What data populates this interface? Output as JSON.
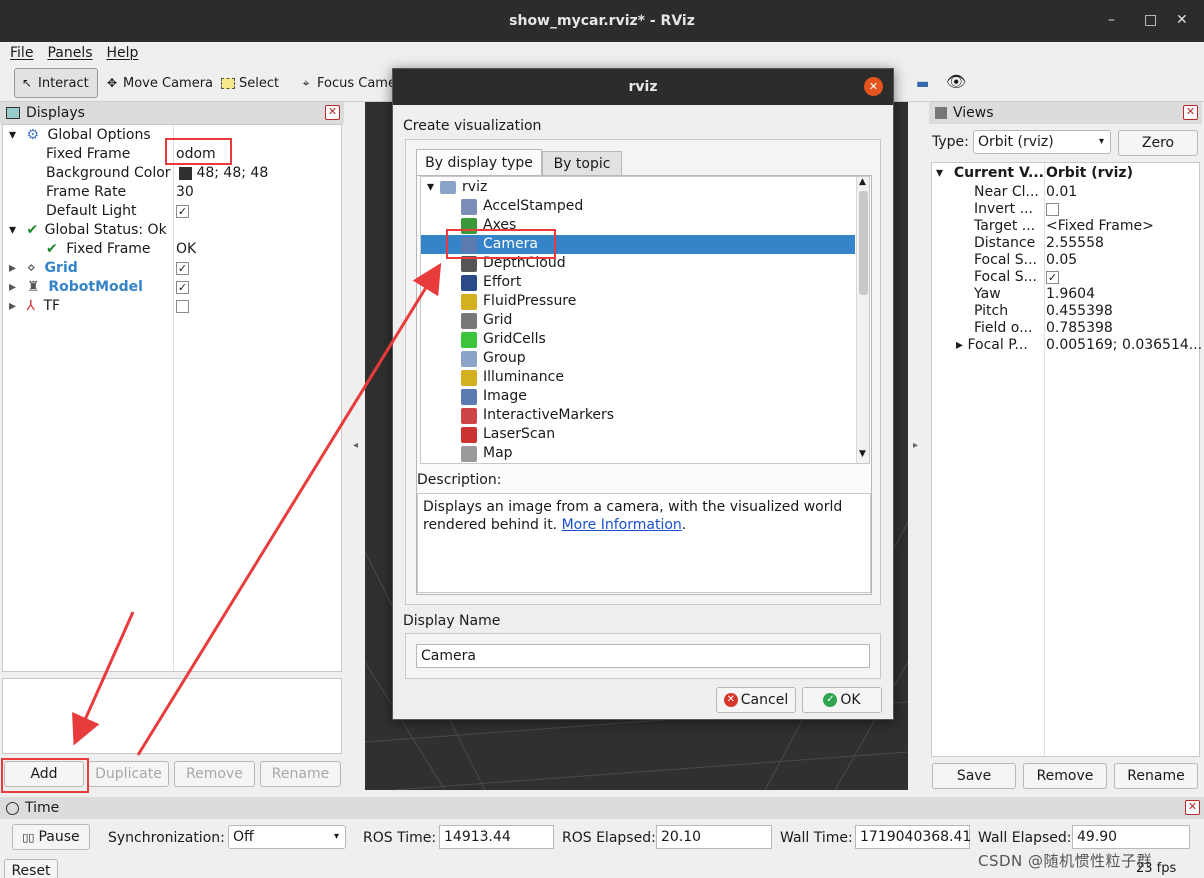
{
  "window": {
    "title": "show_mycar.rviz* - RViz",
    "min": "–",
    "max": "□",
    "close": "✕"
  },
  "menu": {
    "file": "File",
    "panels": "Panels",
    "help": "Help"
  },
  "toolbar": {
    "interact": "Interact",
    "move_camera": "Move Camera",
    "select": "Select",
    "focus_camera": "Focus Camera"
  },
  "displays": {
    "title": "Displays",
    "global_options": "Global Options",
    "fixed_frame_label": "Fixed Frame",
    "fixed_frame_value": "odom",
    "bg_color_label": "Background Color",
    "bg_color_value": "48; 48; 48",
    "frame_rate_label": "Frame Rate",
    "frame_rate_value": "30",
    "default_light_label": "Default Light",
    "global_status": "Global Status: Ok",
    "gs_fixed_frame_label": "Fixed Frame",
    "gs_fixed_frame_value": "OK",
    "grid": "Grid",
    "robot_model": "RobotModel",
    "tf": "TF",
    "buttons": {
      "add": "Add",
      "duplicate": "Duplicate",
      "remove": "Remove",
      "rename": "Rename"
    }
  },
  "dialog": {
    "title": "rviz",
    "create_label": "Create visualization",
    "tab_display_type": "By display type",
    "tab_topic": "By topic",
    "root": "rviz",
    "items": [
      "AccelStamped",
      "Axes",
      "Camera",
      "DepthCloud",
      "Effort",
      "FluidPressure",
      "Grid",
      "GridCells",
      "Group",
      "Illuminance",
      "Image",
      "InteractiveMarkers",
      "LaserScan",
      "Map"
    ],
    "selected": "Camera",
    "description_label": "Description:",
    "description_text": "Displays an image from a camera, with the visualized world rendered behind it.",
    "more_info": "More Information",
    "period": ".",
    "display_name_label": "Display Name",
    "display_name_value": "Camera",
    "cancel": "Cancel",
    "ok": "OK"
  },
  "views": {
    "title": "Views",
    "type_label": "Type:",
    "type_value": "Orbit (rviz)",
    "zero": "Zero",
    "current_view_label": "Current V...",
    "current_view_value": "Orbit (rviz)",
    "props": [
      {
        "k": "Near Cl...",
        "v": "0.01"
      },
      {
        "k": "Invert ...",
        "v": ""
      },
      {
        "k": "Target ...",
        "v": "<Fixed Frame>"
      },
      {
        "k": "Distance",
        "v": "2.55558"
      },
      {
        "k": "Focal S...",
        "v": "0.05"
      },
      {
        "k": "Focal S...",
        "v": ""
      },
      {
        "k": "Yaw",
        "v": "1.9604"
      },
      {
        "k": "Pitch",
        "v": "0.455398"
      },
      {
        "k": "Field o...",
        "v": "0.785398"
      },
      {
        "k": "Focal P...",
        "v": "0.005169; 0.036514..."
      }
    ],
    "save": "Save",
    "remove": "Remove",
    "rename": "Rename"
  },
  "time": {
    "title": "Time",
    "pause": "Pause",
    "sync_label": "Synchronization:",
    "sync_value": "Off",
    "ros_time_label": "ROS Time:",
    "ros_time": "14913.44",
    "ros_elapsed_label": "ROS Elapsed:",
    "ros_elapsed": "20.10",
    "wall_time_label": "Wall Time:",
    "wall_time": "1719040368.41",
    "wall_elapsed_label": "Wall Elapsed:",
    "wall_elapsed": "49.90",
    "reset": "Reset",
    "fps": "23 fps"
  },
  "watermark": "CSDN @随机惯性粒子群",
  "colors": {
    "accent": "#3584c9",
    "annotation": "#e83c3c",
    "titlebar": "#2c2c2c"
  }
}
